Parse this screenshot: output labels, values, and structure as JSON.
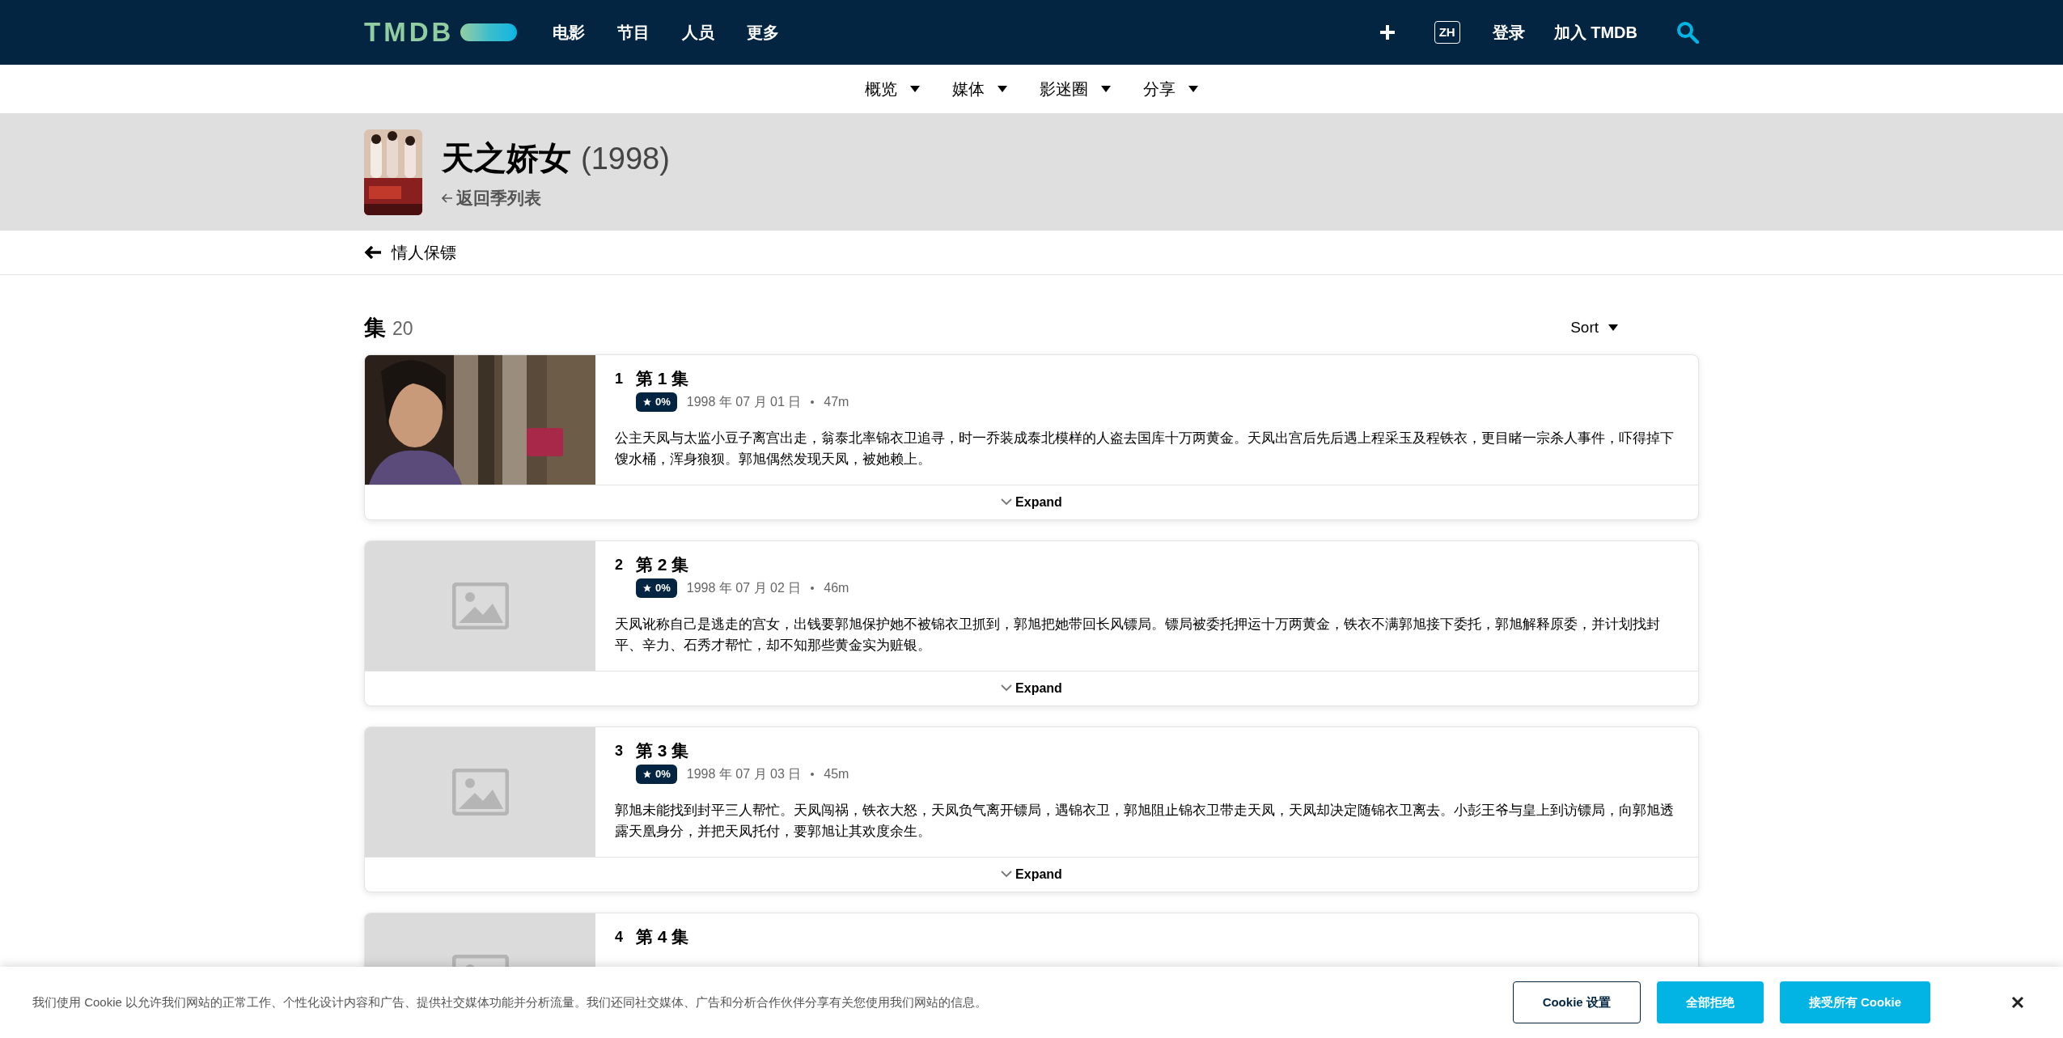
{
  "header": {
    "logo": "TMDB",
    "nav": [
      "电影",
      "节目",
      "人员",
      "更多"
    ],
    "language": "ZH",
    "login": "登录",
    "join": "加入 TMDB"
  },
  "subnav": [
    "概览",
    "媒体",
    "影迷圈",
    "分享"
  ],
  "show": {
    "title": "天之娇女",
    "year": "(1998)",
    "back_link": "返回季列表"
  },
  "season_bar": {
    "title": "情人保镖"
  },
  "episodes_heading": {
    "title": "集",
    "count": "20",
    "sort": "Sort"
  },
  "episodes": [
    {
      "number": "1",
      "title": "第 1 集",
      "rating": "0%",
      "date": "1998 年 07 月 01 日",
      "runtime": "47m",
      "overview": "公主天凤与太监小豆子离宫出走，翁泰北率锦衣卫追寻，时一乔装成泰北模样的人盗去国库十万两黄金。天凤出宫后先后遇上程采玉及程铁衣，更目睹一宗杀人事件，吓得掉下馊水桶，浑身狼狈。郭旭偶然发现天凤，被她赖上。",
      "expand": "Expand",
      "kind": "picture"
    },
    {
      "number": "2",
      "title": "第 2 集",
      "rating": "0%",
      "date": "1998 年 07 月 02 日",
      "runtime": "46m",
      "overview": "天凤讹称自己是逃走的宫女，出钱要郭旭保护她不被锦衣卫抓到，郭旭把她带回长风镖局。镖局被委托押运十万两黄金，铁衣不满郭旭接下委托，郭旭解释原委，并计划找封平、辛力、石秀才帮忙，却不知那些黄金实为赃银。",
      "expand": "Expand",
      "kind": "placeholder"
    },
    {
      "number": "3",
      "title": "第 3 集",
      "rating": "0%",
      "date": "1998 年 07 月 03 日",
      "runtime": "45m",
      "overview": "郭旭未能找到封平三人帮忙。天凤闯祸，铁衣大怒，天凤负气离开镖局，遇锦衣卫，郭旭阻止锦衣卫带走天凤，天凤却决定随锦衣卫离去。小彭王爷与皇上到访镖局，向郭旭透露天凰身分，并把天凤托付，要郭旭让其欢度余生。",
      "expand": "Expand",
      "kind": "placeholder"
    },
    {
      "number": "4",
      "title": "第 4 集",
      "kind": "placeholder"
    }
  ],
  "cookie_banner": {
    "text": "我们使用 Cookie 以允许我们网站的正常工作、个性化设计内容和广告、提供社交媒体功能并分析流量。我们还同社交媒体、广告和分析合作伙伴分享有关您使用我们网站的信息。",
    "buttons": [
      {
        "label": "Cookie 设置",
        "kind": "outline"
      },
      {
        "label": "全部拒绝",
        "kind": "filled"
      },
      {
        "label": "接受所有 Cookie",
        "kind": "filled"
      }
    ]
  }
}
